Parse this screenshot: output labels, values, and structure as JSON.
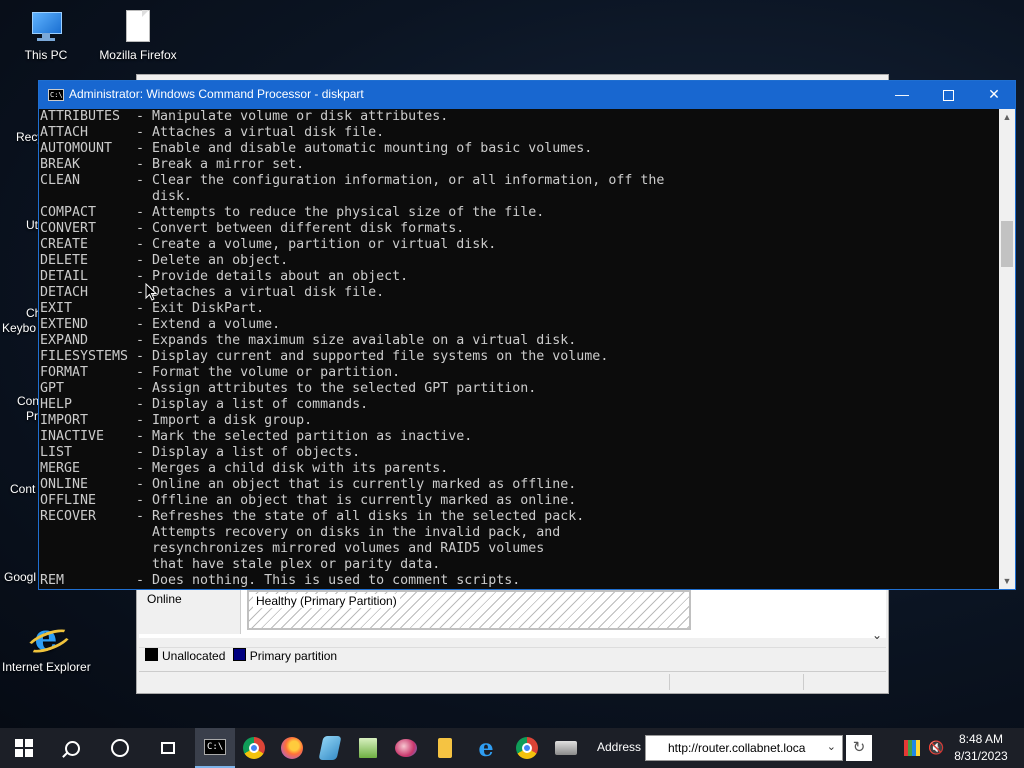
{
  "desktop": {
    "icons": [
      {
        "label": "This PC"
      },
      {
        "label": "Mozilla Firefox"
      },
      {
        "label": "Internet Explorer"
      }
    ],
    "partial_labels": [
      "Recy",
      "Ut",
      "Ch",
      "Keybo",
      "Con",
      "Pr",
      "Cont",
      "Googl"
    ]
  },
  "background_window": {
    "disk_status": "Online",
    "partition_status": "Healthy (Primary Partition)",
    "legend": [
      {
        "label": "Unallocated",
        "color": "#000000"
      },
      {
        "label": "Primary partition",
        "color": "#000080"
      }
    ]
  },
  "console": {
    "title": "Administrator: Windows Command Processor - diskpart",
    "lines": [
      {
        "cmd": "ATTRIBUTES",
        "desc": "- Manipulate volume or disk attributes."
      },
      {
        "cmd": "ATTACH",
        "desc": "- Attaches a virtual disk file."
      },
      {
        "cmd": "AUTOMOUNT",
        "desc": "- Enable and disable automatic mounting of basic volumes."
      },
      {
        "cmd": "BREAK",
        "desc": "- Break a mirror set."
      },
      {
        "cmd": "CLEAN",
        "desc": "- Clear the configuration information, or all information, off the"
      },
      {
        "cmd": "",
        "desc": "  disk."
      },
      {
        "cmd": "COMPACT",
        "desc": "- Attempts to reduce the physical size of the file."
      },
      {
        "cmd": "CONVERT",
        "desc": "- Convert between different disk formats."
      },
      {
        "cmd": "CREATE",
        "desc": "- Create a volume, partition or virtual disk."
      },
      {
        "cmd": "DELETE",
        "desc": "- Delete an object."
      },
      {
        "cmd": "DETAIL",
        "desc": "- Provide details about an object."
      },
      {
        "cmd": "DETACH",
        "desc": "- Detaches a virtual disk file."
      },
      {
        "cmd": "EXIT",
        "desc": "- Exit DiskPart."
      },
      {
        "cmd": "EXTEND",
        "desc": "- Extend a volume."
      },
      {
        "cmd": "EXPAND",
        "desc": "- Expands the maximum size available on a virtual disk."
      },
      {
        "cmd": "FILESYSTEMS",
        "desc": "- Display current and supported file systems on the volume."
      },
      {
        "cmd": "FORMAT",
        "desc": "- Format the volume or partition."
      },
      {
        "cmd": "GPT",
        "desc": "- Assign attributes to the selected GPT partition."
      },
      {
        "cmd": "HELP",
        "desc": "- Display a list of commands."
      },
      {
        "cmd": "IMPORT",
        "desc": "- Import a disk group."
      },
      {
        "cmd": "INACTIVE",
        "desc": "- Mark the selected partition as inactive."
      },
      {
        "cmd": "LIST",
        "desc": "- Display a list of objects."
      },
      {
        "cmd": "MERGE",
        "desc": "- Merges a child disk with its parents."
      },
      {
        "cmd": "ONLINE",
        "desc": "- Online an object that is currently marked as offline."
      },
      {
        "cmd": "OFFLINE",
        "desc": "- Offline an object that is currently marked as online."
      },
      {
        "cmd": "RECOVER",
        "desc": "- Refreshes the state of all disks in the selected pack."
      },
      {
        "cmd": "",
        "desc": "  Attempts recovery on disks in the invalid pack, and"
      },
      {
        "cmd": "",
        "desc": "  resynchronizes mirrored volumes and RAID5 volumes"
      },
      {
        "cmd": "",
        "desc": "  that have stale plex or parity data."
      },
      {
        "cmd": "REM",
        "desc": "- Does nothing. This is used to comment scripts."
      }
    ]
  },
  "taskbar": {
    "address_label": "Address",
    "address_value": "http://router.collabnet.loca",
    "time": "8:48 AM",
    "date": "8/31/2023"
  }
}
